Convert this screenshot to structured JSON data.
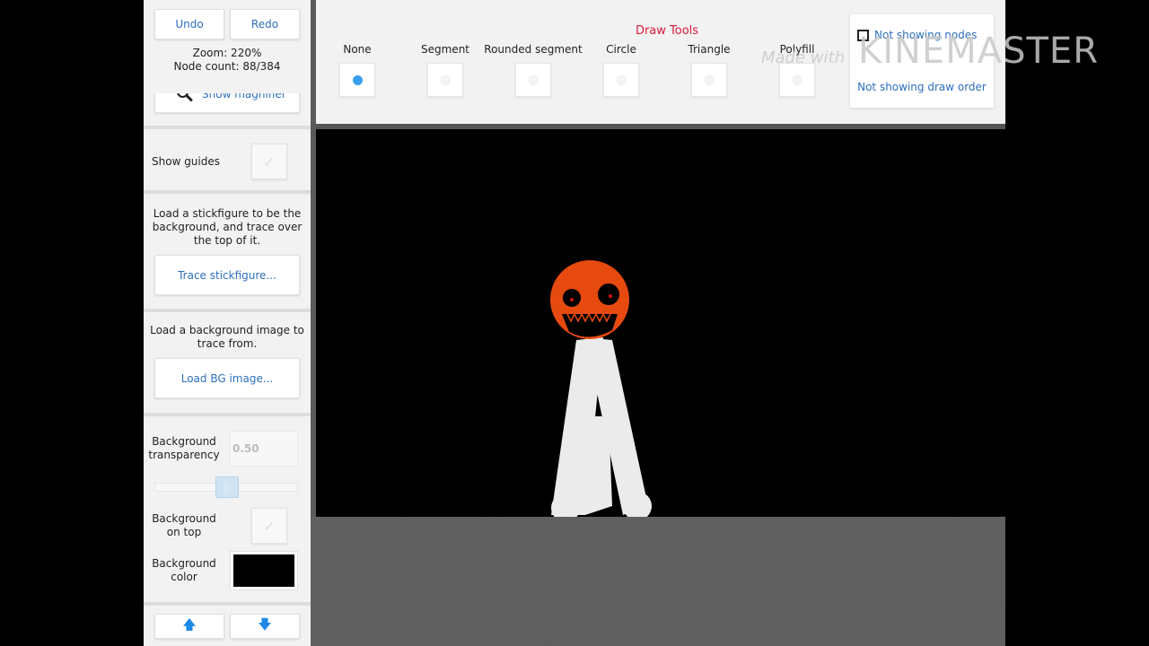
{
  "left_panel": {
    "undo_label": "Undo",
    "redo_label": "Redo",
    "zoom_text": "Zoom: 220%",
    "node_count_text": "Node count: 88/384",
    "magnifier_label": "Show magnifier",
    "show_guides_label": "Show guides",
    "trace_help": "Load a stickfigure to be the background, and trace over the top of it.",
    "trace_button": "Trace stickfigure...",
    "bg_help": "Load a background image to trace from.",
    "load_bg_button": "Load BG image...",
    "bg_transparency_label": "Background transparency",
    "bg_transparency_value": "0.50",
    "bg_transparency_fraction": 0.5,
    "bg_on_top_label": "Background on top",
    "bg_color_label": "Background color",
    "bg_color_value": "#000000",
    "up_arrow": "🡅",
    "down_arrow": "🡇"
  },
  "toolbar": {
    "title": "Draw Tools",
    "title_color": "#d81b3c",
    "tools": [
      {
        "label": "None",
        "selected": true
      },
      {
        "label": "Segment",
        "selected": false
      },
      {
        "label": "Rounded segment",
        "selected": false
      },
      {
        "label": "Circle",
        "selected": false
      },
      {
        "label": "Triangle",
        "selected": false
      },
      {
        "label": "Polyfill",
        "selected": false
      }
    ],
    "nodes_toggle": "Not showing nodes",
    "draw_order_toggle": "Not showing draw order"
  },
  "stage": {
    "background_color": "#000000",
    "head_color": "#e64a0f",
    "body_color": "#ebebeb"
  },
  "watermark": {
    "made_with": "Made with",
    "brand": "KINEMASTER"
  }
}
